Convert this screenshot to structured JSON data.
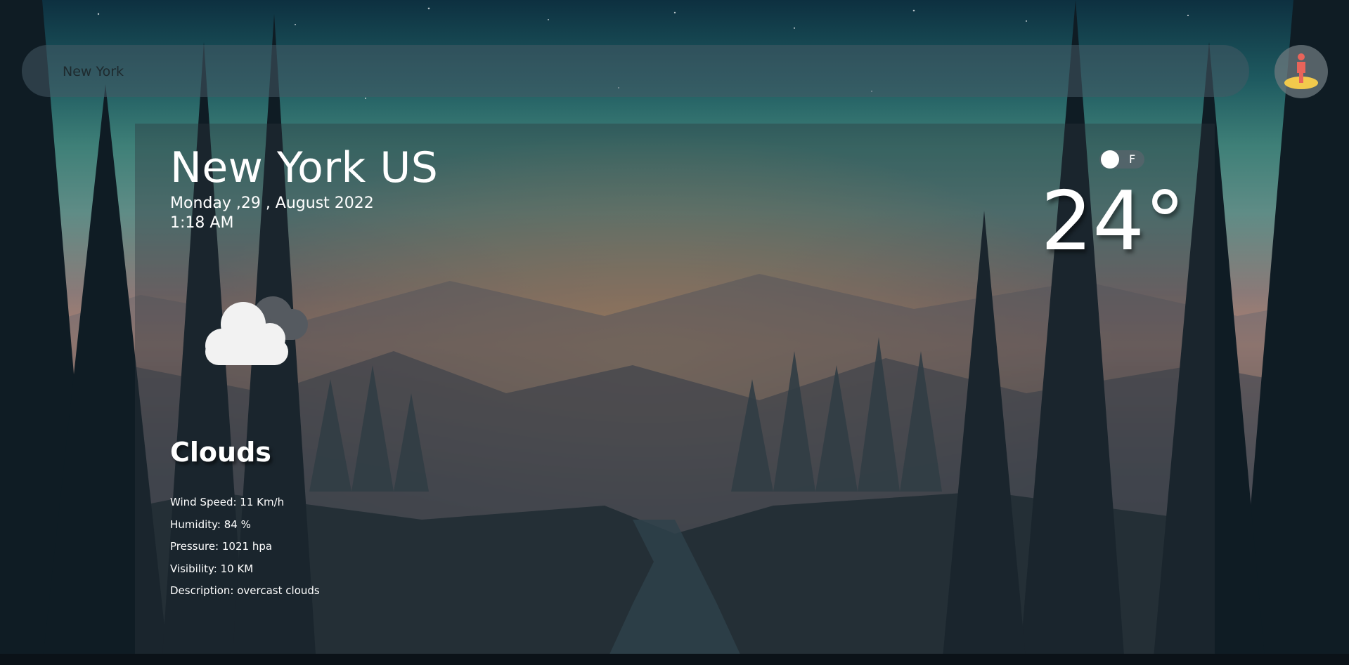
{
  "search": {
    "value": "New York",
    "placeholder": ""
  },
  "location_button": {
    "icon": "person-location-icon"
  },
  "weather": {
    "city": "New York US",
    "date": "Monday ,29 , August 2022",
    "time": "1:18 AM",
    "temperature": "24°",
    "unit_toggle": {
      "label": "F",
      "checked": false
    },
    "icon": "clouds-icon",
    "condition": "Clouds",
    "details": {
      "wind": "Wind Speed: 11 Km/h",
      "humidity": "Humidity: 84 %",
      "pressure": "Pressure: 1021 hpa",
      "visibility": "Visibility: 10 KM",
      "description": "Description: overcast clouds"
    }
  },
  "colors": {
    "text": "#ffffff",
    "card_overlay": "rgba(44,52,60,0.38)",
    "search_bg": "rgba(70,90,100,0.55)",
    "pin_person": "#e8645a",
    "pin_base": "#f2c94c"
  }
}
